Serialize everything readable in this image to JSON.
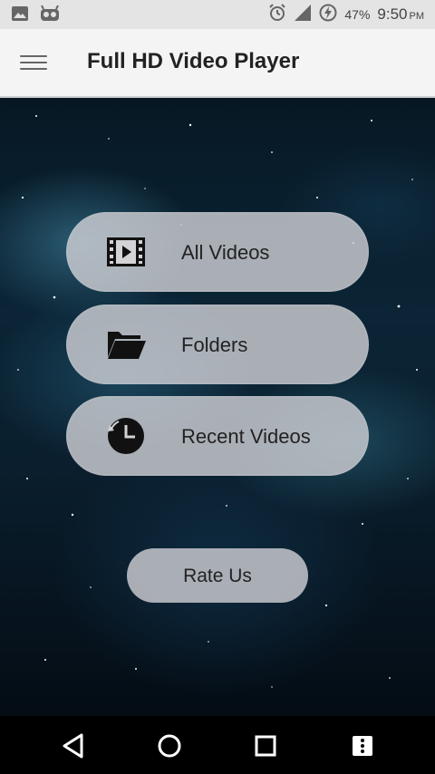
{
  "status_bar": {
    "battery_percent": "47%",
    "time": "9:50",
    "ampm": "PM",
    "icons": [
      "image-icon",
      "android-icon",
      "alarm-icon",
      "signal-icon",
      "battery-charging-icon"
    ]
  },
  "app_bar": {
    "title": "Full HD Video Player",
    "menu_icon": "hamburger-menu-icon"
  },
  "menu": {
    "items": [
      {
        "label": "All Videos",
        "icon": "film-play-icon"
      },
      {
        "label": "Folders",
        "icon": "folder-open-icon"
      },
      {
        "label": "Recent Videos",
        "icon": "clock-history-icon"
      }
    ]
  },
  "rate_button": {
    "label": "Rate Us"
  },
  "nav_bar": {
    "buttons": [
      "back-icon",
      "home-icon",
      "recents-icon",
      "menu-more-icon"
    ]
  },
  "colors": {
    "status_bar_bg": "#e4e4e4",
    "app_bar_bg": "#f4f4f4",
    "card_bg": "#d2d2d7",
    "nav_bar_bg": "#000000"
  }
}
